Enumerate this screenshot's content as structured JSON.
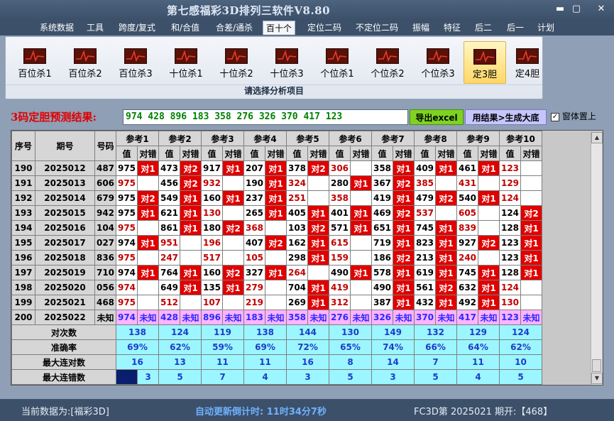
{
  "app": {
    "title": "第七感福彩3D排列三软件V8.80"
  },
  "window_controls": {
    "minimize": "▬",
    "restore": "▢",
    "close": "✕"
  },
  "menu": [
    {
      "label": "系统数据"
    },
    {
      "label": "工具"
    },
    {
      "label": "跨度/复式"
    },
    {
      "label": "和/合值"
    },
    {
      "label": "合差/通杀"
    },
    {
      "label": "百十个"
    },
    {
      "label": "定位二码"
    },
    {
      "label": "不定位二码"
    },
    {
      "label": "振幅"
    },
    {
      "label": "特征"
    },
    {
      "label": "后二"
    },
    {
      "label": "后一"
    },
    {
      "label": "计划"
    }
  ],
  "menu_active": "百十个",
  "ribbon": {
    "items": [
      {
        "label": "百位杀1"
      },
      {
        "label": "百位杀2"
      },
      {
        "label": "百位杀3"
      },
      {
        "label": "十位杀1"
      },
      {
        "label": "十位杀2"
      },
      {
        "label": "十位杀3"
      },
      {
        "label": "个位杀1"
      },
      {
        "label": "个位杀2"
      },
      {
        "label": "个位杀3"
      },
      {
        "label": "定3胆"
      },
      {
        "label": "定4胆"
      }
    ],
    "selected": "定3胆",
    "caption": "请选择分析项目"
  },
  "prediction": {
    "label": "3码定胆预测结果:",
    "value": "974 428 896 183 358 276 326 370 417 123",
    "export_button": "导出excel",
    "apply_button": "用结果>生成大底",
    "on_top_label": "窗体置上",
    "on_top_checked": true
  },
  "table": {
    "headers": {
      "seq": "序号",
      "period": "期号",
      "number": "号码",
      "value": "值",
      "hit": "对错"
    },
    "refs": [
      "参考1",
      "参考2",
      "参考3",
      "参考4",
      "参考5",
      "参考6",
      "参考7",
      "参考8",
      "参考9",
      "参考10"
    ],
    "rows": [
      {
        "seq": "190",
        "period": "2025012",
        "num": "487",
        "cells": [
          [
            "975",
            "对1"
          ],
          [
            "473",
            "对2"
          ],
          [
            "917",
            "对1"
          ],
          [
            "207",
            "对1"
          ],
          [
            "378",
            "对2"
          ],
          [
            "306",
            ""
          ],
          [
            "358",
            "对1"
          ],
          [
            "409",
            "对1"
          ],
          [
            "461",
            "对1"
          ],
          [
            "123",
            ""
          ]
        ]
      },
      {
        "seq": "191",
        "period": "2025013",
        "num": "606",
        "cells": [
          [
            "975",
            ""
          ],
          [
            "456",
            "对2"
          ],
          [
            "932",
            ""
          ],
          [
            "190",
            "对1"
          ],
          [
            "324",
            ""
          ],
          [
            "280",
            "对1"
          ],
          [
            "367",
            "对2"
          ],
          [
            "385",
            ""
          ],
          [
            "431",
            ""
          ],
          [
            "129",
            ""
          ]
        ]
      },
      {
        "seq": "192",
        "period": "2025014",
        "num": "679",
        "cells": [
          [
            "975",
            "对2"
          ],
          [
            "549",
            "对1"
          ],
          [
            "160",
            "对1"
          ],
          [
            "237",
            "对1"
          ],
          [
            "251",
            ""
          ],
          [
            "358",
            ""
          ],
          [
            "419",
            "对1"
          ],
          [
            "479",
            "对2"
          ],
          [
            "540",
            "对1"
          ],
          [
            "124",
            ""
          ]
        ]
      },
      {
        "seq": "193",
        "period": "2025015",
        "num": "942",
        "cells": [
          [
            "975",
            "对1"
          ],
          [
            "621",
            "对1"
          ],
          [
            "130",
            ""
          ],
          [
            "265",
            "对1"
          ],
          [
            "405",
            "对1"
          ],
          [
            "401",
            "对1"
          ],
          [
            "469",
            "对2"
          ],
          [
            "537",
            ""
          ],
          [
            "605",
            ""
          ],
          [
            "124",
            "对2"
          ]
        ]
      },
      {
        "seq": "194",
        "period": "2025016",
        "num": "104",
        "cells": [
          [
            "975",
            ""
          ],
          [
            "861",
            "对1"
          ],
          [
            "180",
            "对2"
          ],
          [
            "368",
            ""
          ],
          [
            "103",
            "对2"
          ],
          [
            "571",
            "对1"
          ],
          [
            "651",
            "对1"
          ],
          [
            "745",
            "对1"
          ],
          [
            "839",
            ""
          ],
          [
            "128",
            "对1"
          ]
        ]
      },
      {
        "seq": "195",
        "period": "2025017",
        "num": "027",
        "cells": [
          [
            "974",
            "对1"
          ],
          [
            "951",
            ""
          ],
          [
            "196",
            ""
          ],
          [
            "407",
            "对2"
          ],
          [
            "162",
            "对1"
          ],
          [
            "615",
            ""
          ],
          [
            "719",
            "对1"
          ],
          [
            "823",
            "对1"
          ],
          [
            "927",
            "对2"
          ],
          [
            "123",
            "对1"
          ]
        ]
      },
      {
        "seq": "196",
        "period": "2025018",
        "num": "836",
        "cells": [
          [
            "975",
            ""
          ],
          [
            "247",
            ""
          ],
          [
            "517",
            ""
          ],
          [
            "105",
            ""
          ],
          [
            "298",
            "对1"
          ],
          [
            "159",
            ""
          ],
          [
            "186",
            "对2"
          ],
          [
            "213",
            "对1"
          ],
          [
            "240",
            ""
          ],
          [
            "123",
            "对1"
          ]
        ]
      },
      {
        "seq": "197",
        "period": "2025019",
        "num": "710",
        "cells": [
          [
            "974",
            "对1"
          ],
          [
            "764",
            "对1"
          ],
          [
            "160",
            "对2"
          ],
          [
            "327",
            "对1"
          ],
          [
            "264",
            ""
          ],
          [
            "490",
            "对1"
          ],
          [
            "578",
            "对1"
          ],
          [
            "619",
            "对1"
          ],
          [
            "745",
            "对1"
          ],
          [
            "128",
            "对1"
          ]
        ]
      },
      {
        "seq": "198",
        "period": "2025020",
        "num": "056",
        "cells": [
          [
            "974",
            ""
          ],
          [
            "649",
            "对1"
          ],
          [
            "135",
            "对1"
          ],
          [
            "279",
            ""
          ],
          [
            "704",
            "对1"
          ],
          [
            "419",
            ""
          ],
          [
            "490",
            "对1"
          ],
          [
            "561",
            "对2"
          ],
          [
            "632",
            "对1"
          ],
          [
            "124",
            ""
          ]
        ]
      },
      {
        "seq": "199",
        "period": "2025021",
        "num": "468",
        "cells": [
          [
            "975",
            ""
          ],
          [
            "512",
            ""
          ],
          [
            "107",
            ""
          ],
          [
            "219",
            ""
          ],
          [
            "269",
            "对1"
          ],
          [
            "312",
            ""
          ],
          [
            "387",
            "对1"
          ],
          [
            "432",
            "对1"
          ],
          [
            "492",
            "对1"
          ],
          [
            "130",
            ""
          ]
        ]
      }
    ],
    "pending": {
      "seq": "200",
      "period": "2025022",
      "num": "未知",
      "values": [
        "974",
        "428",
        "896",
        "183",
        "358",
        "276",
        "326",
        "370",
        "417",
        "123"
      ],
      "status": "未知"
    },
    "stats": [
      {
        "label": "对次数",
        "values": [
          "138",
          "124",
          "119",
          "138",
          "144",
          "130",
          "149",
          "132",
          "129",
          "124"
        ]
      },
      {
        "label": "准确率",
        "values": [
          "69%",
          "62%",
          "59%",
          "69%",
          "72%",
          "65%",
          "74%",
          "66%",
          "64%",
          "62%"
        ]
      },
      {
        "label": "最大连对数",
        "values": [
          "16",
          "13",
          "11",
          "11",
          "16",
          "8",
          "14",
          "7",
          "11",
          "10"
        ]
      },
      {
        "label": "最大连错数",
        "values": [
          "3",
          "5",
          "7",
          "4",
          "3",
          "5",
          "3",
          "5",
          "4",
          "5"
        ]
      }
    ]
  },
  "status": {
    "data_source": "当前数据为:[福彩3D]",
    "countdown": "自动更新倒计时: 11时34分7秒",
    "draw_info": "FC3D第 2025021 期开:【468】"
  }
}
